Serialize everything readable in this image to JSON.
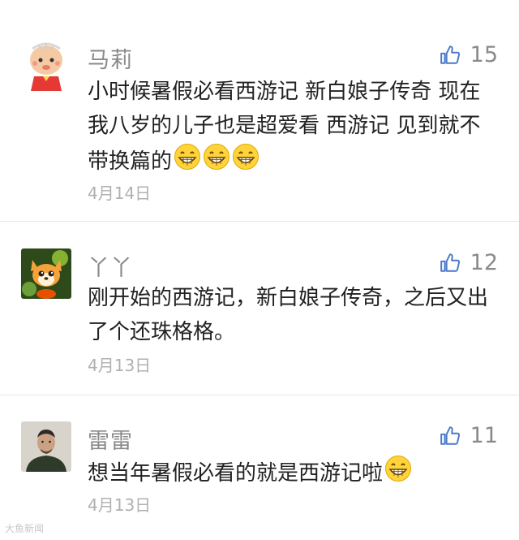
{
  "comments": [
    {
      "name": "马莉",
      "likes": "15",
      "text": "小时候暑假必看西游记  新白娘子传奇  现在我八岁的儿子也是超爱看  西游记  见到就不带换篇的",
      "emoji_count": 3,
      "date": "4月14日",
      "avatar_icon": "cartoon-girl-avatar"
    },
    {
      "name": "丫丫",
      "likes": "12",
      "text": "刚开始的西游记，新白娘子传奇，之后又出了个还珠格格。",
      "emoji_count": 0,
      "date": "4月13日",
      "avatar_icon": "cartoon-fox-avatar"
    },
    {
      "name": "雷雷",
      "likes": "11",
      "text": "想当年暑假必看的就是西游记啦",
      "emoji_count": 1,
      "date": "4月13日",
      "avatar_icon": "man-photo-avatar"
    }
  ],
  "watermark": "大鱼新闻",
  "colors": {
    "accent_like": "#4a79c8",
    "name": "#8a8a8a",
    "text": "#222222",
    "date": "#b0b0b0"
  }
}
